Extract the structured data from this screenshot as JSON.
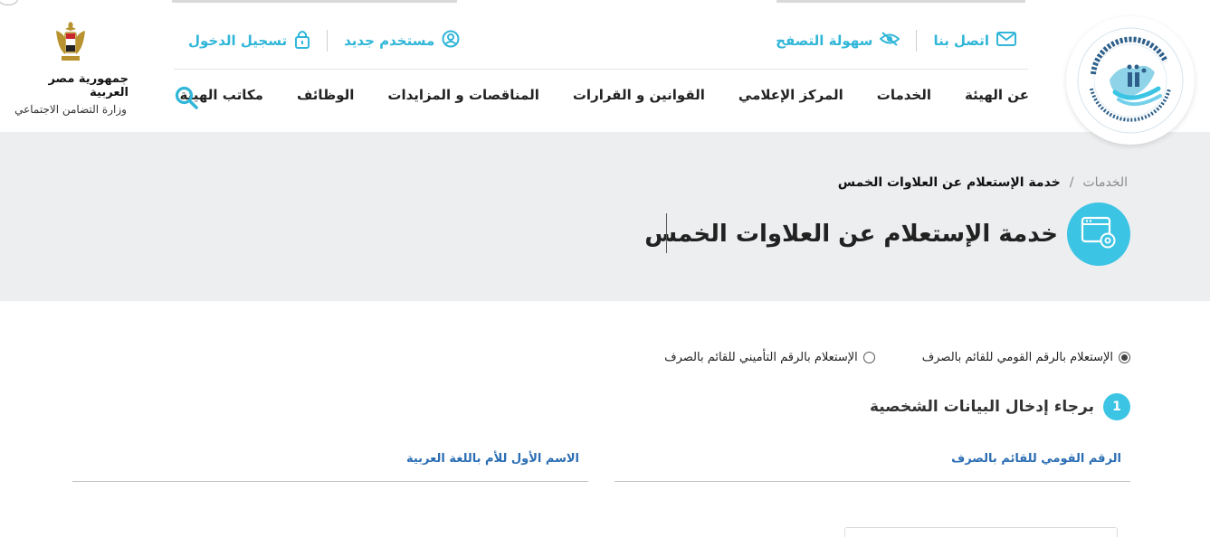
{
  "header": {
    "utility_right": {
      "contact_label": "اتصل بنا",
      "accessibility_label": "سهولة التصفح"
    },
    "utility_left": {
      "new_user_label": "مستخدم جديد",
      "login_label": "تسجيل الدخول"
    },
    "nav": [
      {
        "label": "عن الهيئة"
      },
      {
        "label": "الخدمات"
      },
      {
        "label": "المركز الإعلامي"
      },
      {
        "label": "القوانين و القرارات"
      },
      {
        "label": "المناقصات و المزايدات"
      },
      {
        "label": "الوظائف"
      },
      {
        "label": "مكاتب الهيئة"
      }
    ],
    "gov": {
      "country": "جمهورية مصر العربية",
      "ministry": "وزارة التضامن الاجتماعي"
    }
  },
  "banner": {
    "breadcrumb_home": "الخدمات",
    "breadcrumb_sep": "/",
    "breadcrumb_current": "خدمة الإستعلام عن العلاوات الخمس",
    "title": "خدمة الإستعلام عن العلاوات الخمس"
  },
  "form": {
    "radio_options": [
      {
        "label": "الإستعلام بالرقم القومي للقائم بالصرف",
        "selected": true
      },
      {
        "label": "الإستعلام بالرقم التأميني للقائم بالصرف",
        "selected": false
      }
    ],
    "step_number": "1",
    "step_title": "برجاء إدخال البيانات الشخصية",
    "fields": {
      "national_id_label": "الرقم القومي للقائم بالصرف",
      "mother_name_label": "الاسم الأول للأم باللغة العربية"
    }
  },
  "colors": {
    "accent": "#3cc4e4",
    "link": "#30b6d8",
    "label": "#2a6db3",
    "banner_bg": "#eceef0"
  },
  "icons": {
    "contact": "envelope-icon",
    "accessibility": "eye-slash-icon",
    "new_user": "user-circle-icon",
    "login": "lock-icon",
    "search": "search-icon",
    "title": "browser-gear-icon"
  }
}
